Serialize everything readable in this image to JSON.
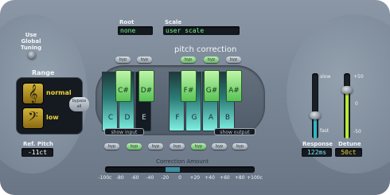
{
  "global": {
    "label": "Use Global\nTuning"
  },
  "root": {
    "label": "Root",
    "value": "none"
  },
  "scale": {
    "label": "Scale",
    "value": "user scale"
  },
  "title": "pitch correction",
  "range": {
    "label": "Range",
    "normal": "normal",
    "low": "low"
  },
  "ref_pitch": {
    "label": "Ref. Pitch",
    "value": "-11ct"
  },
  "bypass_all": "bypass\nall",
  "byp": "byp",
  "black_keys": [
    {
      "label": "C#"
    },
    {
      "label": "D#"
    },
    {
      "label": "F#"
    },
    {
      "label": "G#"
    },
    {
      "label": "A#"
    }
  ],
  "white_keys": [
    {
      "label": "C"
    },
    {
      "label": "D"
    },
    {
      "label": "E"
    },
    {
      "label": "F"
    },
    {
      "label": "G"
    },
    {
      "label": "A"
    },
    {
      "label": "B"
    }
  ],
  "show_input": "show input",
  "show_output": "show output",
  "correction": {
    "label": "Correction Amount",
    "scale": [
      "-100c",
      "-80",
      "-60",
      "-40",
      "-20",
      "0",
      "+20",
      "+40",
      "+60",
      "+80",
      "+100c"
    ]
  },
  "response": {
    "label": "Response",
    "value": "122ms",
    "slow": "slow",
    "fast": "fast",
    "level": 0.35
  },
  "detune": {
    "label": "Detune",
    "value": "50ct",
    "plus": "+50",
    "zero": "0",
    "minus": "-50",
    "level": 0.75
  },
  "colors": {
    "lcd_text": "#79f090",
    "lit_key": "#7ef0e2",
    "black_key": "#58c356",
    "gold": "#f1d23a"
  }
}
